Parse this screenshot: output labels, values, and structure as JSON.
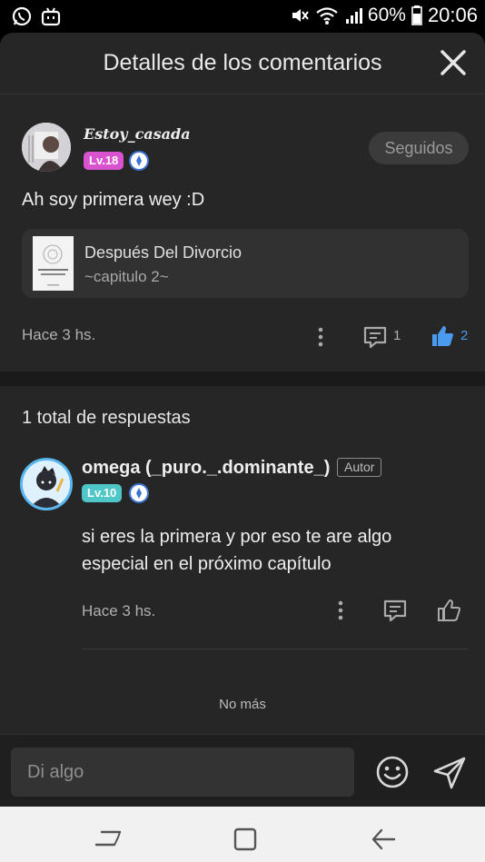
{
  "status_bar": {
    "battery": "60%",
    "time": "20:06"
  },
  "header": {
    "title": "Detalles de los comentarios"
  },
  "comment": {
    "username": "Estoy_casada",
    "level": "Lv.18",
    "follow_label": "Seguidos",
    "text": "Ah soy primera wey :D",
    "book": {
      "title": "Después Del Divorcio",
      "chapter": "~capitulo 2~"
    },
    "time": "Hace 3 hs.",
    "reply_count": "1",
    "like_count": "2"
  },
  "replies": {
    "heading": "1 total de respuestas",
    "items": [
      {
        "username": "omega (_puro._.dominante_)",
        "author_tag": "Autor",
        "level": "Lv.10",
        "text": "si eres la primera y por eso te are algo especial en el próximo capítulo",
        "time": "Hace 3 hs."
      }
    ],
    "end_label": "No más"
  },
  "input": {
    "placeholder": "Di algo"
  },
  "colors": {
    "background": "#262626",
    "like_blue": "#4a9bf0",
    "level18": "#d952cf",
    "level10": "#4fc6c8"
  }
}
